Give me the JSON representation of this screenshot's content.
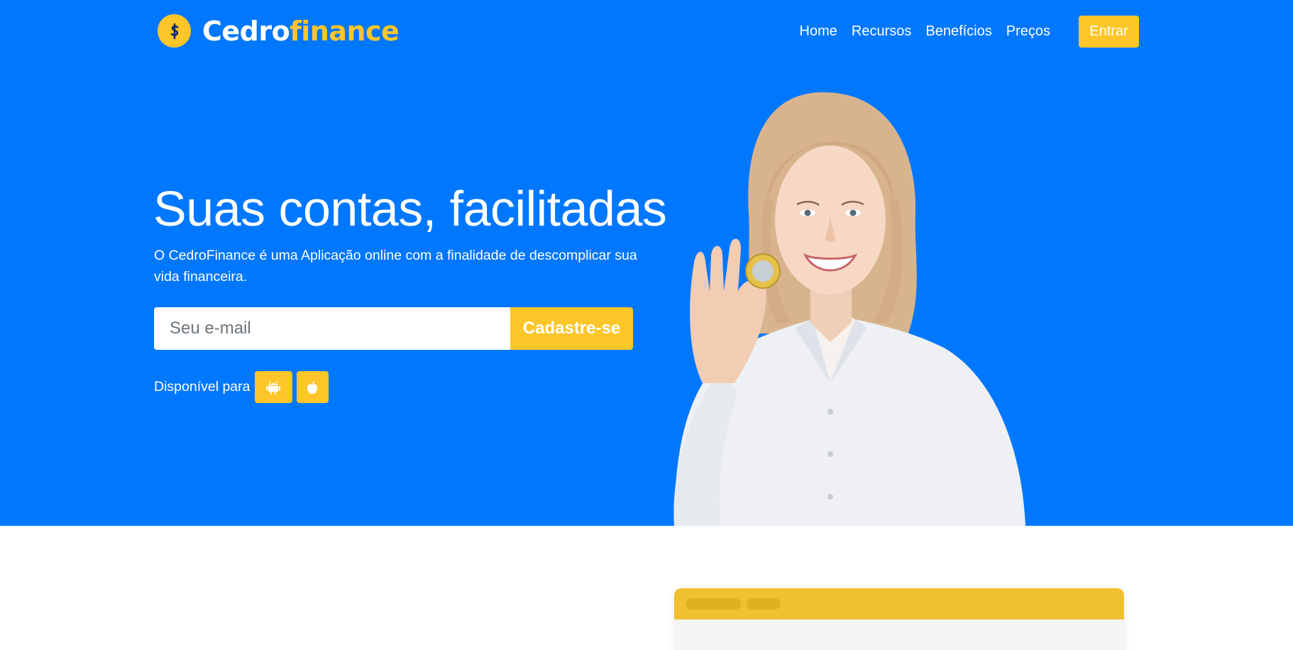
{
  "brand": {
    "name_part1": "Cedro",
    "name_part2": "finance"
  },
  "nav": {
    "items": [
      {
        "label": "Home"
      },
      {
        "label": "Recursos"
      },
      {
        "label": "Benefícios"
      },
      {
        "label": "Preços"
      }
    ],
    "login_label": "Entrar"
  },
  "hero": {
    "title": "Suas contas, facilitadas",
    "subtitle": "O CedroFinance é uma Aplicação online com a finalidade de descomplicar sua vida financeira.",
    "email_placeholder": "Seu e-mail",
    "signup_label": "Cadastre-se",
    "available_label": "Disponível para",
    "stores": [
      {
        "icon": "android-icon"
      },
      {
        "icon": "apple-icon"
      }
    ]
  },
  "colors": {
    "primary": "#0077ff",
    "accent": "#ffc629",
    "card_header": "#f0c030"
  }
}
